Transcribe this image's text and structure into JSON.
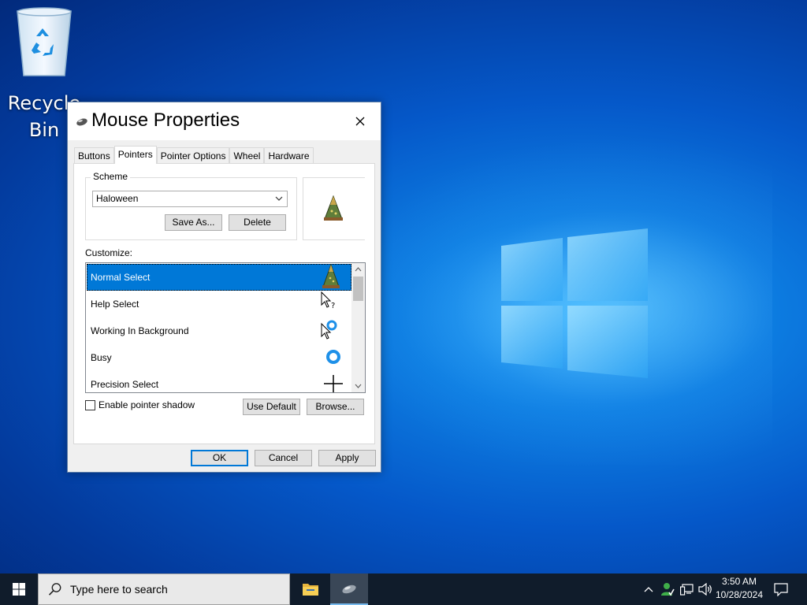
{
  "desktop": {
    "recycle_bin_label_line1": "Recycle",
    "recycle_bin_label_line2": "Bin"
  },
  "dialog": {
    "title": "Mouse Properties",
    "tabs": [
      {
        "label": "Buttons",
        "active": false
      },
      {
        "label": "Pointers",
        "active": true
      },
      {
        "label": "Pointer Options",
        "active": false
      },
      {
        "label": "Wheel",
        "active": false
      },
      {
        "label": "Hardware",
        "active": false
      }
    ],
    "scheme": {
      "group_label": "Scheme",
      "selected": "Haloween",
      "save_as_label": "Save As...",
      "delete_label": "Delete"
    },
    "customize": {
      "label": "Customize:",
      "items": [
        {
          "label": "Normal Select",
          "icon": "witch-hat-cursor-icon",
          "selected": true
        },
        {
          "label": "Help Select",
          "icon": "help-select-cursor-icon",
          "selected": false
        },
        {
          "label": "Working In Background",
          "icon": "working-in-background-cursor-icon",
          "selected": false
        },
        {
          "label": "Busy",
          "icon": "busy-ring-cursor-icon",
          "selected": false
        },
        {
          "label": "Precision Select",
          "icon": "crosshair-cursor-icon",
          "selected": false
        }
      ]
    },
    "enable_pointer_shadow": {
      "label": "Enable pointer shadow",
      "checked": false
    },
    "use_default_label": "Use Default",
    "browse_label": "Browse...",
    "ok_label": "OK",
    "cancel_label": "Cancel",
    "apply_label": "Apply"
  },
  "taskbar": {
    "search_placeholder": "Type here to search",
    "time": "3:50 AM",
    "date": "10/28/2024"
  },
  "colors": {
    "accent": "#0078d7",
    "taskbar": "#101c2b",
    "desktop_blue": "#0a6ad8"
  }
}
